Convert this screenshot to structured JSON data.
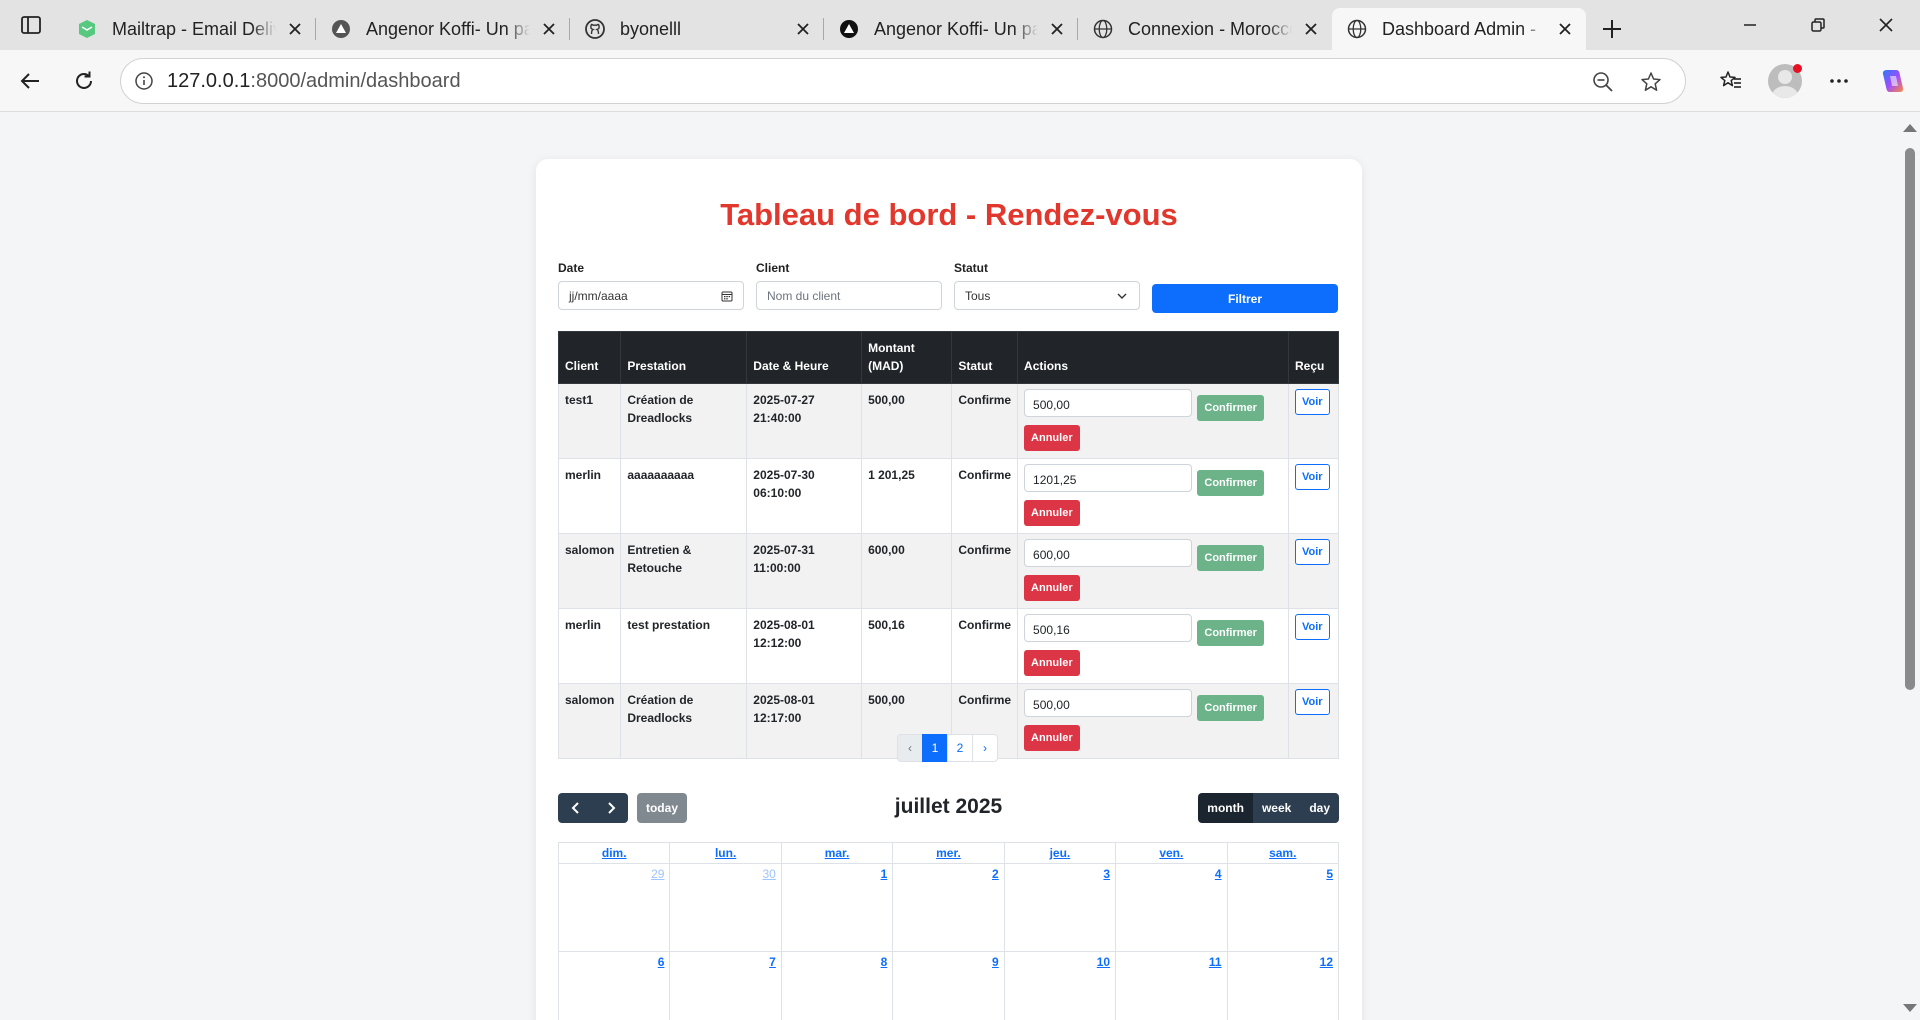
{
  "browser": {
    "tabs": [
      {
        "title": "Mailtrap - Email Delivery Platform",
        "icon": "mailtrap-icon",
        "active": false
      },
      {
        "title": "Angenor Koffi- Un passionné",
        "icon": "triangle-logo-icon",
        "active": false
      },
      {
        "title": "byonelll",
        "icon": "github-icon",
        "active": false
      },
      {
        "title": "Angenor Koffi- Un passionné",
        "icon": "triangle-logo-icon",
        "active": false
      },
      {
        "title": "Connexion - Morocco",
        "icon": "globe-icon",
        "active": false
      },
      {
        "title": "Dashboard Admin - ",
        "icon": "globe-icon",
        "active": true
      }
    ],
    "url_host": "127.0.0.1",
    "url_rest": ":8000/admin/dashboard"
  },
  "page": {
    "title": "Tableau de bord - Rendez-vous",
    "filters": {
      "date_label": "Date",
      "date_value": "jj/mm/aaaa",
      "client_label": "Client",
      "client_placeholder": "Nom du client",
      "status_label": "Statut",
      "status_value": "Tous",
      "submit_label": "Filtrer"
    },
    "table": {
      "headers": [
        "Client",
        "Prestation",
        "Date & Heure",
        "Montant (MAD)",
        "Statut",
        "Actions",
        "Reçu"
      ],
      "confirm_label": "Confirmer",
      "cancel_label": "Annuler",
      "receipt_label": "Voir",
      "rows": [
        {
          "client": "test1",
          "service": "Création de Dreadlocks",
          "date": "2025-07-27",
          "time": "21:40:00",
          "amount": "500,00",
          "status": "Confirme",
          "input": "500,00"
        },
        {
          "client": "merlin",
          "service": "aaaaaaaaaa",
          "date": "2025-07-30",
          "time": "06:10:00",
          "amount": "1 201,25",
          "status": "Confirme",
          "input": "1201,25"
        },
        {
          "client": "salomon",
          "service": "Entretien & Retouche",
          "date": "2025-07-31",
          "time": "11:00:00",
          "amount": "600,00",
          "status": "Confirme",
          "input": "600,00"
        },
        {
          "client": "merlin",
          "service": "test prestation",
          "date": "2025-08-01",
          "time": "12:12:00",
          "amount": "500,16",
          "status": "Confirme",
          "input": "500,16"
        },
        {
          "client": "salomon",
          "service": "Création de Dreadlocks",
          "date": "2025-08-01",
          "time": "12:17:00",
          "amount": "500,00",
          "status": "Confirme",
          "input": "500,00"
        }
      ]
    },
    "pagination": {
      "prev": "‹",
      "pages": [
        "1",
        "2"
      ],
      "current": "1",
      "next": "›"
    },
    "calendar": {
      "title": "juillet 2025",
      "today_label": "today",
      "views": [
        "month",
        "week",
        "day"
      ],
      "active_view": "month",
      "weekdays": [
        "dim.",
        "lun.",
        "mar.",
        "mer.",
        "jeu.",
        "ven.",
        "sam."
      ],
      "weeks": [
        [
          "29",
          "30",
          "1",
          "2",
          "3",
          "4",
          "5"
        ],
        [
          "6",
          "7",
          "8",
          "9",
          "10",
          "11",
          "12"
        ]
      ]
    }
  },
  "colors": {
    "title_red": "#e2372c",
    "primary": "#0d6efd",
    "success": "#6cb38a",
    "danger": "#dc3545",
    "table_head": "#212529",
    "calendar_nav": "#2c3e50"
  }
}
